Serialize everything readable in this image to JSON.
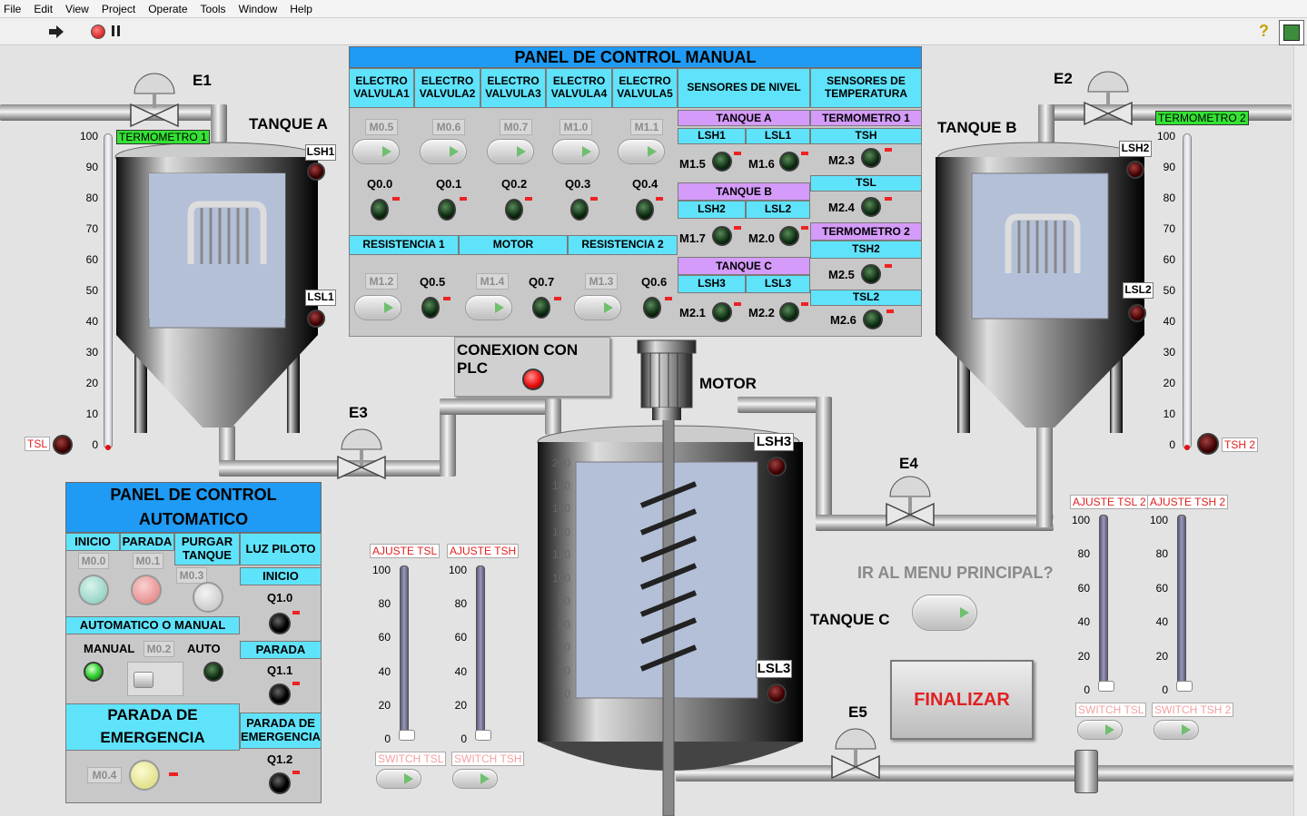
{
  "menu": [
    "File",
    "Edit",
    "View",
    "Project",
    "Operate",
    "Tools",
    "Window",
    "Help"
  ],
  "manual": {
    "title": "PANEL DE CONTROL MANUAL",
    "valve_headers": [
      "ELECTRO VALVULA1",
      "ELECTRO VALVULA2",
      "ELECTRO VALVULA3",
      "ELECTRO VALVULA4",
      "ELECTRO VALVULA5"
    ],
    "valve_inputs": [
      "M0.5",
      "M0.6",
      "M0.7",
      "M1.0",
      "M1.1"
    ],
    "valve_outputs": [
      "Q0.0",
      "Q0.1",
      "Q0.2",
      "Q0.3",
      "Q0.4"
    ],
    "sensores_nivel": "SENSORES DE NIVEL",
    "sensores_temp": "SENSORES DE TEMPERATURA",
    "tanque_a": "TANQUE A",
    "tanque_b": "TANQUE B",
    "tanque_c": "TANQUE C",
    "lsh1": "LSH1",
    "lsl1": "LSL1",
    "lsh2": "LSH2",
    "lsl2": "LSL2",
    "lsh3": "LSH3",
    "lsl3": "LSL3",
    "m15": "M1.5",
    "m16": "M1.6",
    "m17": "M1.7",
    "m20": "M2.0",
    "m21": "M2.1",
    "m22": "M2.2",
    "termometro1": "TERMOMETRO 1",
    "termometro2": "TERMOMETRO 2",
    "tsh": "TSH",
    "tsl": "TSL",
    "tsh2": "TSH2",
    "tsl2": "TSL2",
    "m23": "M2.3",
    "m24": "M2.4",
    "m25": "M2.5",
    "m26": "M2.6",
    "resistencia1": "RESISTENCIA 1",
    "motor": "MOTOR",
    "resistencia2": "RESISTENCIA 2",
    "m12": "M1.2",
    "q05": "Q0.5",
    "m14": "M1.4",
    "q07": "Q0.7",
    "m13": "M1.3",
    "q06": "Q0.6"
  },
  "plc": {
    "label": "CONEXION CON PLC"
  },
  "plant": {
    "e1": "E1",
    "e2": "E2",
    "e3": "E3",
    "e4": "E4",
    "e5": "E5",
    "tanque_a": "TANQUE A",
    "tanque_b": "TANQUE B",
    "tanque_c": "TANQUE C",
    "motor": "MOTOR",
    "lsh1": "LSH1",
    "lsl1": "LSL1",
    "lsh2": "LSH2",
    "lsl2": "LSL2",
    "lsh3": "LSH3",
    "lsl3": "LSL3",
    "termometro1": "TERMOMETRO 1",
    "termometro2": "TERMOMETRO 2",
    "tsl": "TSL",
    "tsh2": "TSH 2"
  },
  "thermo_ticks": [
    "100",
    "90",
    "80",
    "70",
    "60",
    "50",
    "40",
    "30",
    "20",
    "10",
    "0"
  ],
  "tankab_ticks": [
    "100",
    "90",
    "80",
    "70",
    "60",
    "50",
    "40",
    "30",
    "20",
    "10",
    "0"
  ],
  "tankc_ticks": [
    "200",
    "180",
    "160",
    "140",
    "120",
    "100",
    "80",
    "60",
    "40",
    "20",
    "0"
  ],
  "slider_ticks": [
    "100",
    "80",
    "60",
    "40",
    "20",
    "0"
  ],
  "auto": {
    "title1": "PANEL DE CONTROL",
    "title2": "AUTOMATICO",
    "inicio": "INICIO",
    "parada": "PARADA",
    "purgar": "PURGAR TANQUE",
    "luz": "LUZ PILOTO",
    "m00": "M0.0",
    "m01": "M0.1",
    "m03": "M0.3",
    "luz_inicio": "INICIO",
    "q10": "Q1.0",
    "auto_manual": "AUTOMATICO O MANUAL",
    "manual": "MANUAL",
    "m02": "M0.2",
    "auto": "AUTO",
    "luz_parada": "PARADA",
    "q11": "Q1.1",
    "parada_em1": "PARADA DE",
    "parada_em2": "EMERGENCIA",
    "luz_em1": "PARADA DE",
    "luz_em2": "EMERGENCIA",
    "q12": "Q1.2",
    "m04": "M0.4"
  },
  "sliders": {
    "ajuste_tsl": "AJUSTE TSL",
    "ajuste_tsh": "AJUSTE TSH",
    "switch_tsl": "SWITCH TSL",
    "switch_tsh": "SWITCH TSH",
    "ajuste_tsl2": "AJUSTE TSL 2",
    "ajuste_tsh2": "AJUSTE TSH 2",
    "switch_tsl2": "SWITCH TSL",
    "switch_tsh2": "SWITCH TSH 2"
  },
  "nav": {
    "menu": "IR AL MENU PRINCIPAL?",
    "finalizar": "FINALIZAR"
  }
}
